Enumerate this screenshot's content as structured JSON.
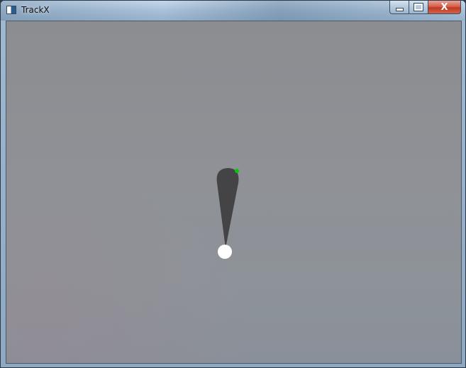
{
  "window": {
    "title": "TrackX",
    "icon": "app-window-icon",
    "buttons": {
      "minimize": "minimize-icon",
      "maximize": "maximize-icon",
      "close": "close-icon",
      "close_glyph": "X"
    }
  },
  "colors": {
    "background": "#8f9196",
    "pointer_body": "#444446",
    "pivot": "#ffffff",
    "tip_marker": "#00cc00",
    "close_button": "#c2381f"
  }
}
